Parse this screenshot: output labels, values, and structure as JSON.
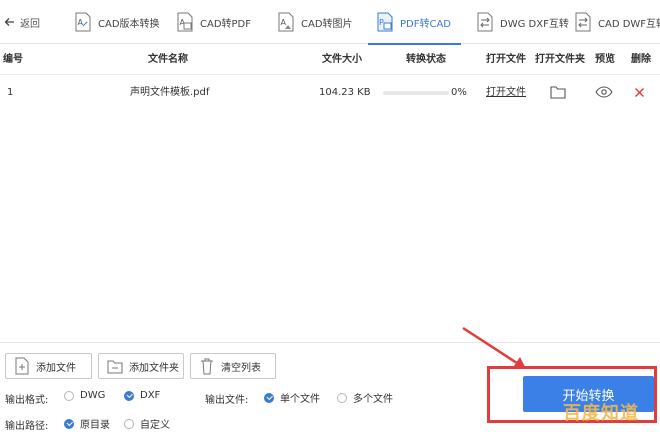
{
  "topbar": {
    "back_label": "返回",
    "tabs": [
      {
        "label": "CAD版本转换"
      },
      {
        "label": "CAD转PDF"
      },
      {
        "label": "CAD转图片"
      },
      {
        "label": "PDF转CAD"
      },
      {
        "label": "DWG DXF互转"
      },
      {
        "label": "CAD DWF互转"
      }
    ],
    "active_tab": "PDF转CAD",
    "accent_color": "#3a7bd5"
  },
  "table": {
    "headers": {
      "index": "编号",
      "name": "文件名称",
      "size": "文件大小",
      "status": "转换状态",
      "open_file": "打开文件",
      "open_folder": "打开文件夹",
      "preview": "预览",
      "delete": "删除"
    },
    "rows": [
      {
        "index": "1",
        "name": "声明文件模板.pdf",
        "size": "104.23 KB",
        "progress": 0,
        "progress_label": "0%",
        "open_file": "打开文件",
        "folder_icon": "folder-icon",
        "preview_icon": "eye-icon",
        "delete_icon": "close-icon"
      }
    ]
  },
  "actions": {
    "add_file": "添加文件",
    "add_folder": "添加文件夹",
    "clear_list": "清空列表"
  },
  "options": {
    "format_label": "输出格式:",
    "formats": [
      {
        "label": "DWG",
        "selected": false
      },
      {
        "label": "DXF",
        "selected": true
      }
    ],
    "output_file_label": "输出文件:",
    "output_files": [
      {
        "label": "单个文件",
        "selected": true
      },
      {
        "label": "多个文件",
        "selected": false
      }
    ],
    "path_label": "输出路径:",
    "paths": [
      {
        "label": "原目录",
        "selected": true
      },
      {
        "label": "自定义",
        "selected": false
      }
    ]
  },
  "start_button": "开始转换",
  "watermark": "百度知道",
  "highlight_color": "#e23b3b"
}
